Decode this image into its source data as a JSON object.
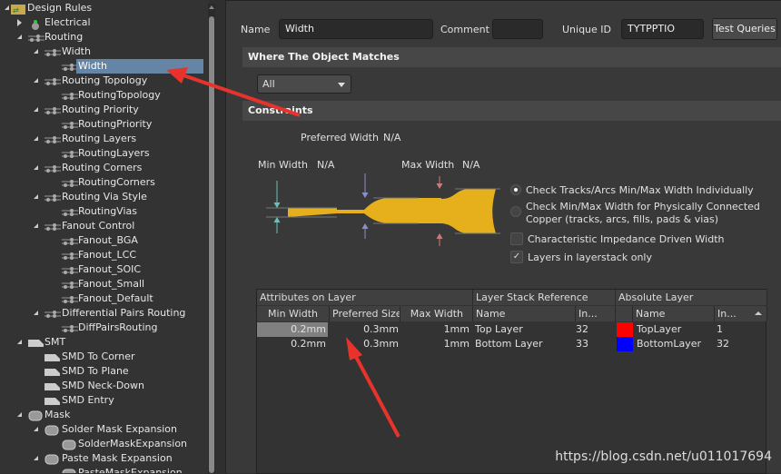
{
  "tree": [
    {
      "level": 0,
      "label": "Design Rules",
      "icon": "folder-icon",
      "expander": "open"
    },
    {
      "level": 1,
      "label": "Electrical",
      "icon": "electrical-icon",
      "expander": "closed"
    },
    {
      "level": 1,
      "label": "Routing",
      "icon": "rule-icon",
      "expander": "open"
    },
    {
      "level": 2,
      "label": "Width",
      "icon": "rule-icon",
      "expander": "open"
    },
    {
      "level": 3,
      "label": "Width",
      "icon": "rule-icon",
      "selected": true
    },
    {
      "level": 2,
      "label": "Routing Topology",
      "icon": "rule-icon",
      "expander": "open"
    },
    {
      "level": 3,
      "label": "RoutingTopology",
      "icon": "rule-icon"
    },
    {
      "level": 2,
      "label": "Routing Priority",
      "icon": "rule-icon",
      "expander": "open"
    },
    {
      "level": 3,
      "label": "RoutingPriority",
      "icon": "rule-icon"
    },
    {
      "level": 2,
      "label": "Routing Layers",
      "icon": "rule-icon",
      "expander": "open"
    },
    {
      "level": 3,
      "label": "RoutingLayers",
      "icon": "rule-icon"
    },
    {
      "level": 2,
      "label": "Routing Corners",
      "icon": "rule-icon",
      "expander": "open"
    },
    {
      "level": 3,
      "label": "RoutingCorners",
      "icon": "rule-icon"
    },
    {
      "level": 2,
      "label": "Routing Via Style",
      "icon": "rule-icon",
      "expander": "open"
    },
    {
      "level": 3,
      "label": "RoutingVias",
      "icon": "rule-icon"
    },
    {
      "level": 2,
      "label": "Fanout Control",
      "icon": "rule-icon",
      "expander": "open"
    },
    {
      "level": 3,
      "label": "Fanout_BGA",
      "icon": "rule-icon"
    },
    {
      "level": 3,
      "label": "Fanout_LCC",
      "icon": "rule-icon"
    },
    {
      "level": 3,
      "label": "Fanout_SOIC",
      "icon": "rule-icon"
    },
    {
      "level": 3,
      "label": "Fanout_Small",
      "icon": "rule-icon"
    },
    {
      "level": 3,
      "label": "Fanout_Default",
      "icon": "rule-icon"
    },
    {
      "level": 2,
      "label": "Differential Pairs Routing",
      "icon": "rule-icon",
      "expander": "open"
    },
    {
      "level": 3,
      "label": "DiffPairsRouting",
      "icon": "rule-icon"
    },
    {
      "level": 1,
      "label": "SMT",
      "icon": "smt-icon",
      "expander": "open"
    },
    {
      "level": 2,
      "label": "SMD To Corner",
      "icon": "smt-icon"
    },
    {
      "level": 2,
      "label": "SMD To Plane",
      "icon": "smt-icon"
    },
    {
      "level": 2,
      "label": "SMD Neck-Down",
      "icon": "smt-icon"
    },
    {
      "level": 2,
      "label": "SMD Entry",
      "icon": "smt-icon"
    },
    {
      "level": 1,
      "label": "Mask",
      "icon": "mask-icon",
      "expander": "open"
    },
    {
      "level": 2,
      "label": "Solder Mask Expansion",
      "icon": "mask-icon",
      "expander": "open"
    },
    {
      "level": 3,
      "label": "SolderMaskExpansion",
      "icon": "mask-icon"
    },
    {
      "level": 2,
      "label": "Paste Mask Expansion",
      "icon": "mask-icon",
      "expander": "open"
    },
    {
      "level": 3,
      "label": "PasteMaskExpansion",
      "icon": "mask-icon"
    }
  ],
  "header": {
    "name_label": "Name",
    "name_value": "Width",
    "comment_label": "Comment",
    "comment_value": "",
    "uid_label": "Unique ID",
    "uid_value": "TYTPPTIO",
    "test_queries": "Test Queries"
  },
  "where": {
    "title": "Where The Object Matches",
    "selected": "All"
  },
  "constraints": {
    "title": "Constraints",
    "preferred_label": "Preferred Width",
    "preferred_value": "N/A",
    "min_label": "Min Width",
    "min_value": "N/A",
    "max_label": "Max Width",
    "max_value": "N/A",
    "track_color": "#e5b01c",
    "options": [
      {
        "label": "Check Tracks/Arcs Min/Max Width Individually",
        "type": "radio",
        "checked": true
      },
      {
        "label": "Check Min/Max Width for Physically Connected",
        "label2": "Copper (tracks, arcs, fills, pads & vias)",
        "type": "radio",
        "checked": false
      },
      {
        "label": "Characteristic Impedance Driven Width",
        "type": "checkbox",
        "checked": false
      },
      {
        "label": "Layers in layerstack only",
        "type": "checkbox",
        "checked": true
      }
    ]
  },
  "grid": {
    "groups": [
      "Attributes on Layer",
      "Layer Stack Reference",
      "Absolute Layer"
    ],
    "columns": [
      "Min Width",
      "Preferred Size",
      "Max Width",
      "Name",
      "In...",
      "",
      "Name",
      "In..."
    ],
    "rows": [
      {
        "min": "0.2mm",
        "pref": "0.3mm",
        "max": "1mm",
        "stack_name": "Top Layer",
        "stack_index": "32",
        "color": "#ff0000",
        "abs_name": "TopLayer",
        "abs_index": "1"
      },
      {
        "min": "0.2mm",
        "pref": "0.3mm",
        "max": "1mm",
        "stack_name": "Bottom Layer",
        "stack_index": "33",
        "color": "#0000ff",
        "abs_name": "BottomLayer",
        "abs_index": "32"
      }
    ]
  },
  "watermark": "https://blog.csdn.net/u011017694",
  "annotation_color": "#e8322c"
}
